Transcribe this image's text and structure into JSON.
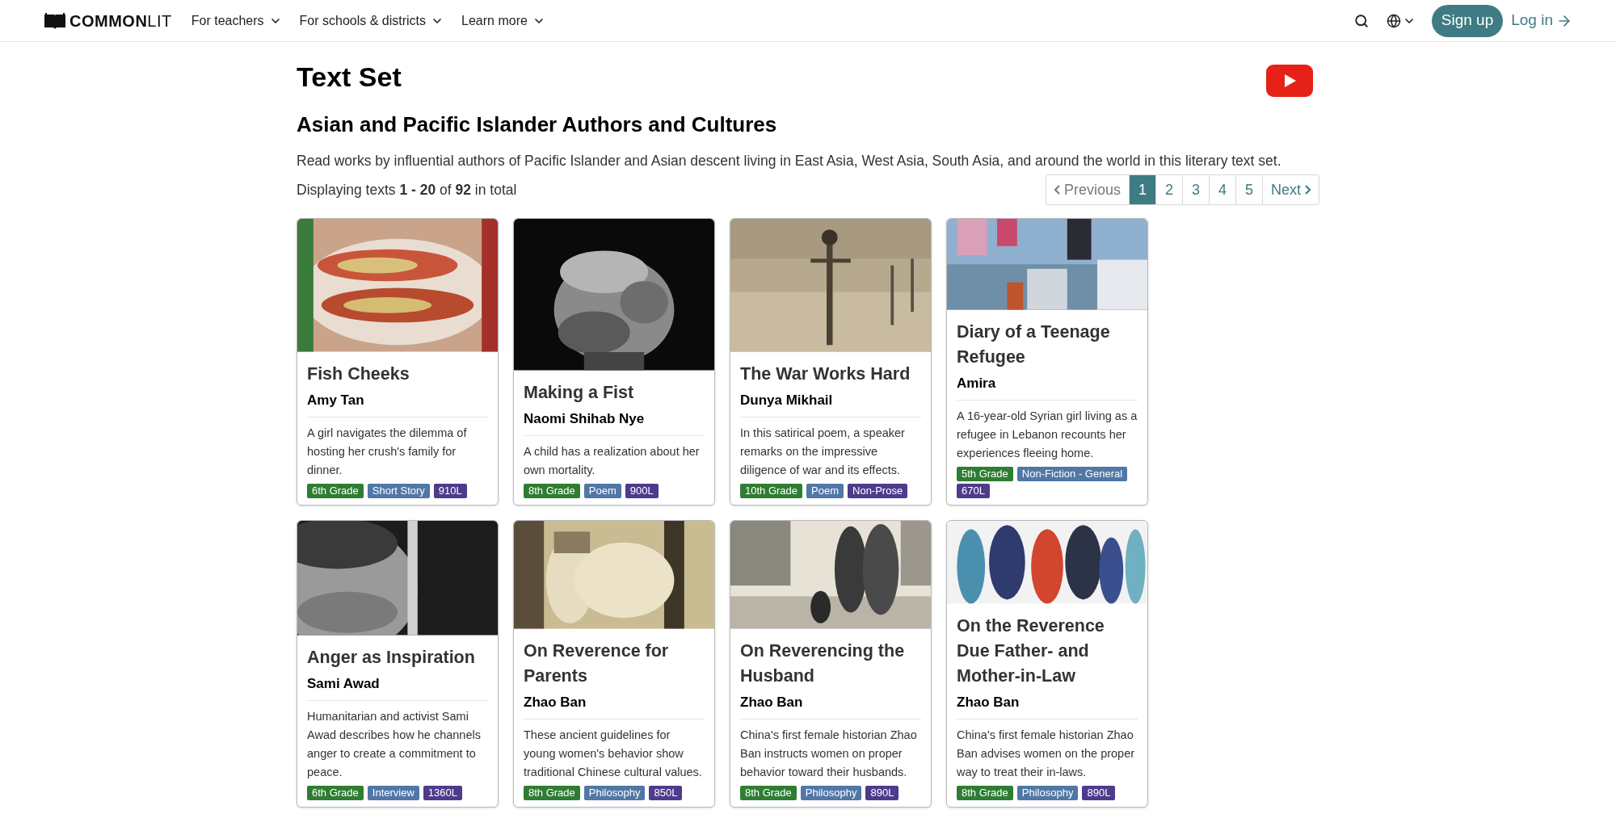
{
  "header": {
    "logo": "**COMMON**LIT",
    "nav": [
      "For teachers",
      "For schools & districts",
      "Learn more"
    ],
    "sign_up": "Sign up",
    "log_in": "Log in"
  },
  "page_title": "Text Set",
  "set_title": "Asian and Pacific Islander Authors and Cultures",
  "description": "Read works by influential authors of Pacific Islander and Asian descent living in East Asia, West Asia, South Asia, and around the world in this literary text set.",
  "count": "Displaying texts **1 - 20** of **92** in total",
  "pagination": {
    "previous": "Previous",
    "next": "Next",
    "pages": [
      {
        "label": "1",
        "selected": true
      },
      {
        "label": "2",
        "selected": false
      },
      {
        "label": "3",
        "selected": false
      },
      {
        "label": "4",
        "selected": false
      },
      {
        "label": "5",
        "selected": false
      }
    ]
  },
  "cards": [
    {
      "title": "Fish Cheeks",
      "author": "Amy Tan",
      "summary": "A girl navigates the dilemma of hosting her crush's family for dinner.",
      "tags": [
        {
          "kind": "grade",
          "text": "6th Grade"
        },
        {
          "kind": "genre",
          "text": "Short Story"
        },
        {
          "kind": "lexile",
          "text": "910L"
        }
      ]
    },
    {
      "title": "Making a Fist",
      "author": "Naomi Shihab Nye",
      "summary": "A child has a realization about her own mortality.",
      "tags": [
        {
          "kind": "grade",
          "text": "8th Grade"
        },
        {
          "kind": "genre",
          "text": "Poem"
        },
        {
          "kind": "lexile",
          "text": "900L"
        }
      ]
    },
    {
      "title": "The War Works Hard",
      "author": "Dunya Mikhail",
      "summary": "In this satirical poem, a speaker remarks on the impressive diligence of war and its effects.",
      "tags": [
        {
          "kind": "grade",
          "text": "10th Grade"
        },
        {
          "kind": "genre",
          "text": "Poem"
        },
        {
          "kind": "lexile",
          "text": "Non-Prose"
        }
      ]
    },
    {
      "title": "Diary of a Teenage Refugee",
      "author": "Amira",
      "summary": "A 16-year-old Syrian girl living as a refugee in Lebanon recounts her experiences fleeing home.",
      "tags": [
        {
          "kind": "grade",
          "text": "5th Grade"
        },
        {
          "kind": "genre",
          "text": "Non-Fiction - General"
        },
        {
          "kind": "lexile",
          "text": "670L"
        }
      ]
    },
    {
      "title": "Anger as Inspiration",
      "author": "Sami Awad",
      "summary": "Humanitarian and activist Sami Awad describes how he channels anger to create a commitment to peace.",
      "tags": [
        {
          "kind": "grade",
          "text": "6th Grade"
        },
        {
          "kind": "genre",
          "text": "Interview"
        },
        {
          "kind": "lexile",
          "text": "1360L"
        }
      ]
    },
    {
      "title": "On Reverence for Parents",
      "author": "Zhao Ban",
      "summary": "These ancient guidelines for young women's behavior show traditional Chinese cultural values.",
      "tags": [
        {
          "kind": "grade",
          "text": "8th Grade"
        },
        {
          "kind": "genre",
          "text": "Philosophy"
        },
        {
          "kind": "lexile",
          "text": "850L"
        }
      ]
    },
    {
      "title": "On Reverencing the Husband",
      "author": "Zhao Ban",
      "summary": "China's first female historian Zhao Ban instructs women on proper behavior toward their husbands.",
      "tags": [
        {
          "kind": "grade",
          "text": "8th Grade"
        },
        {
          "kind": "genre",
          "text": "Philosophy"
        },
        {
          "kind": "lexile",
          "text": "890L"
        }
      ]
    },
    {
      "title": "On the Reverence Due Father- and Mother-in-Law",
      "author": "Zhao Ban",
      "summary": "China's first female historian Zhao Ban advises women on the proper way to treat their in-laws.",
      "tags": [
        {
          "kind": "grade",
          "text": "8th Grade"
        },
        {
          "kind": "genre",
          "text": "Philosophy"
        },
        {
          "kind": "lexile",
          "text": "890L"
        }
      ]
    }
  ]
}
